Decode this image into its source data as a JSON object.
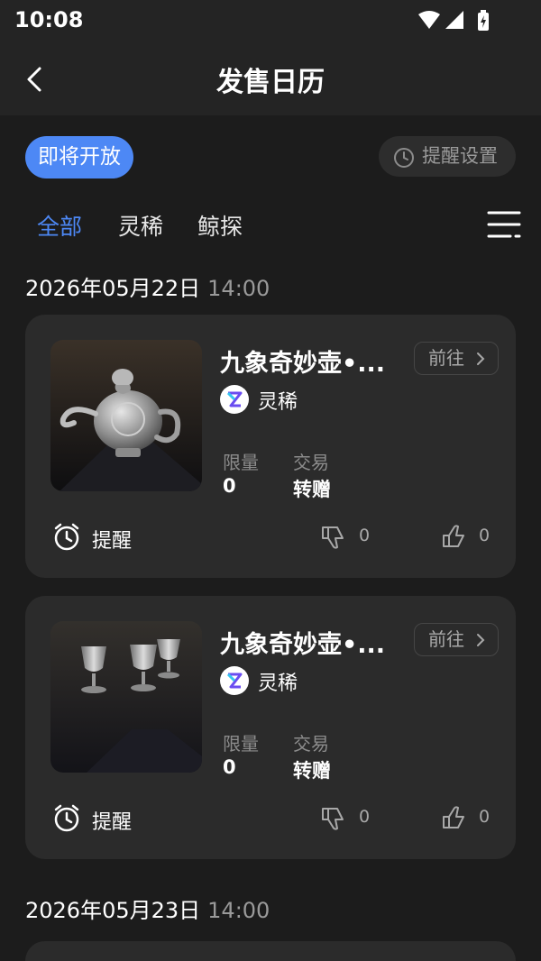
{
  "status": {
    "time": "10:08"
  },
  "header": {
    "title": "发售日历"
  },
  "filters": {
    "upcoming_label": "即将开放",
    "reminder_settings_label": "提醒设置"
  },
  "tabs": [
    {
      "label": "全部",
      "active": true
    },
    {
      "label": "灵稀",
      "active": false
    },
    {
      "label": "鲸探",
      "active": false
    }
  ],
  "groups": [
    {
      "date": "2026年05月22日",
      "time": "14:00",
      "items": [
        {
          "title": "九象奇妙壶•...",
          "platform": "灵稀",
          "goto_label": "前往",
          "limit_label": "限量",
          "limit_value": "0",
          "trade_label": "交易",
          "trade_value": "转赠",
          "remind_label": "提醒",
          "dislikes": "0",
          "likes": "0",
          "image": "silver-teapot"
        },
        {
          "title": "九象奇妙壶•...",
          "platform": "灵稀",
          "goto_label": "前往",
          "limit_label": "限量",
          "limit_value": "0",
          "trade_label": "交易",
          "trade_value": "转赠",
          "remind_label": "提醒",
          "dislikes": "0",
          "likes": "0",
          "image": "silver-goblets"
        }
      ]
    },
    {
      "date": "2026年05月23日",
      "time": "14:00",
      "items": []
    }
  ],
  "colors": {
    "accent": "#4d88f5",
    "background": "#1c1c1c",
    "card": "#2b2b2b"
  }
}
